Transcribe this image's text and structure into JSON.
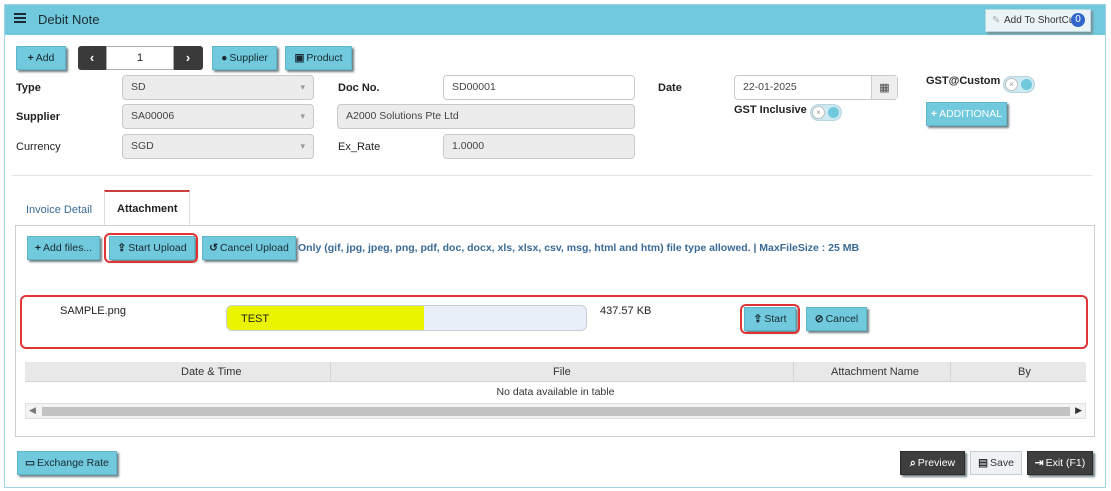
{
  "window": {
    "title": "Debit Note",
    "shortcut_label": "Add To ShortCut",
    "shortcut_count": "0"
  },
  "toolbar": {
    "add": "Add",
    "page": "1",
    "supplier": "Supplier",
    "product": "Product"
  },
  "form": {
    "type_label": "Type",
    "type_value": "SD",
    "supplier_label": "Supplier",
    "supplier_value": "SA00006",
    "currency_label": "Currency",
    "currency_value": "SGD",
    "docno_label": "Doc No.",
    "docno_value": "SD00001",
    "supplier_name": "A2000 Solutions Pte Ltd",
    "exrate_label": "Ex_Rate",
    "exrate_value": "1.0000",
    "date_label": "Date",
    "date_value": "22-01-2025",
    "gst_inclusive_label": "GST Inclusive",
    "gst_custom_label": "GST@Custom",
    "additional": "ADDITIONAL"
  },
  "tabs": [
    {
      "label": "Invoice Detail"
    },
    {
      "label": "Attachment"
    }
  ],
  "attachment": {
    "add_files": "Add files...",
    "start_upload": "Start Upload",
    "cancel_upload": "Cancel Upload",
    "note": "Only (gif, jpg, jpeg, png, pdf, doc, docx, xls, xlsx, csv, msg, html and htm) file type allowed. | MaxFileSize : 25 MB",
    "file": {
      "name": "SAMPLE.png",
      "progress_text": "TEST",
      "progress_fraction": 0.55,
      "size": "437.57 KB",
      "start": "Start",
      "cancel": "Cancel"
    },
    "table": {
      "columns": [
        "Date & Time",
        "File",
        "Attachment Name",
        "By"
      ],
      "empty": "No data available in table"
    }
  },
  "footer": {
    "exchange_rate": "Exchange Rate",
    "preview": "Preview",
    "save": "Save",
    "exit": "Exit (F1)"
  },
  "colors": {
    "accent": "#70c9dc",
    "highlight": "#e03434",
    "progress_fill": "#eaf400"
  }
}
